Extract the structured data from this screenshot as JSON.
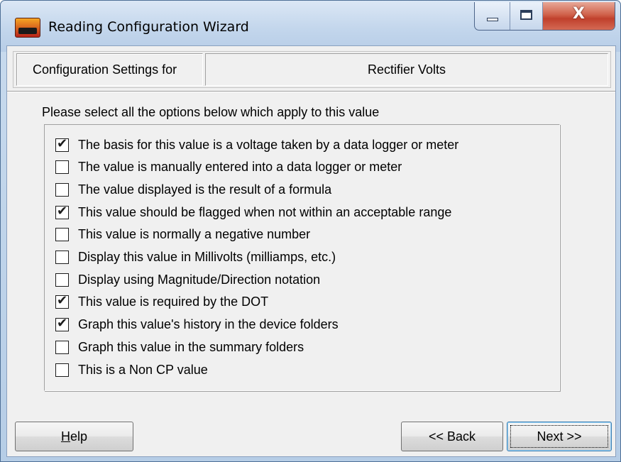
{
  "window": {
    "title": "Reading Configuration Wizard",
    "controls": {
      "minimize": "minimize",
      "maximize": "maximize",
      "close": "x"
    }
  },
  "header": {
    "label": "Configuration Settings for",
    "value": "Rectifier Volts"
  },
  "instructions": "Please select all the options below which apply to this value",
  "options": [
    {
      "label": "The basis for this value is a voltage taken by a data logger or meter",
      "checked": true
    },
    {
      "label": "The value is manually entered into a data logger or meter",
      "checked": false
    },
    {
      "label": "The value displayed is the result of a formula",
      "checked": false
    },
    {
      "label": "This value should be flagged when not within an acceptable range",
      "checked": true
    },
    {
      "label": "This value is normally a negative number",
      "checked": false
    },
    {
      "label": "Display this value in Millivolts (milliamps, etc.)",
      "checked": false
    },
    {
      "label": "Display using Magnitude/Direction notation",
      "checked": false
    },
    {
      "label": "This value is required by the DOT",
      "checked": true
    },
    {
      "label": "Graph this value's history in the device folders",
      "checked": true
    },
    {
      "label": "Graph this value in the summary folders",
      "checked": false
    },
    {
      "label": "This is a Non CP value",
      "checked": false
    }
  ],
  "buttons": {
    "help_mnemonic": "H",
    "help_rest": "elp",
    "back": "<< Back",
    "next": "Next >>"
  },
  "icons": {
    "app": "app-logo-icon",
    "check": "checkmark-icon"
  }
}
